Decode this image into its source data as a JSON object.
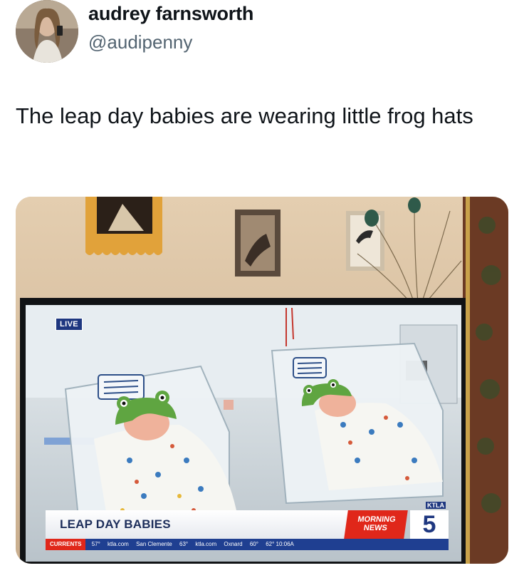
{
  "author": {
    "display_name": "audrey farnsworth",
    "handle": "@audipenny",
    "avatar_icon": "profile-photo"
  },
  "tweet": {
    "text": "The leap day babies are wearing little frog hats"
  },
  "media": {
    "broadcast": {
      "live_badge": "LIVE",
      "headline": "LEAP DAY BABIES",
      "program": "MORNING NEWS",
      "channel_number": "5",
      "station": "KTLA",
      "ticker_label": "CURRENTS",
      "ticker_items": [
        "57°",
        "ktla.com",
        "San Clemente",
        "63°",
        "ktla.com",
        "Oxnard",
        "60°",
        "62° 10:06A"
      ]
    },
    "colors": {
      "frog_hat": "#5fa541",
      "news_red": "#e0271a",
      "news_blue": "#1e3780"
    }
  }
}
